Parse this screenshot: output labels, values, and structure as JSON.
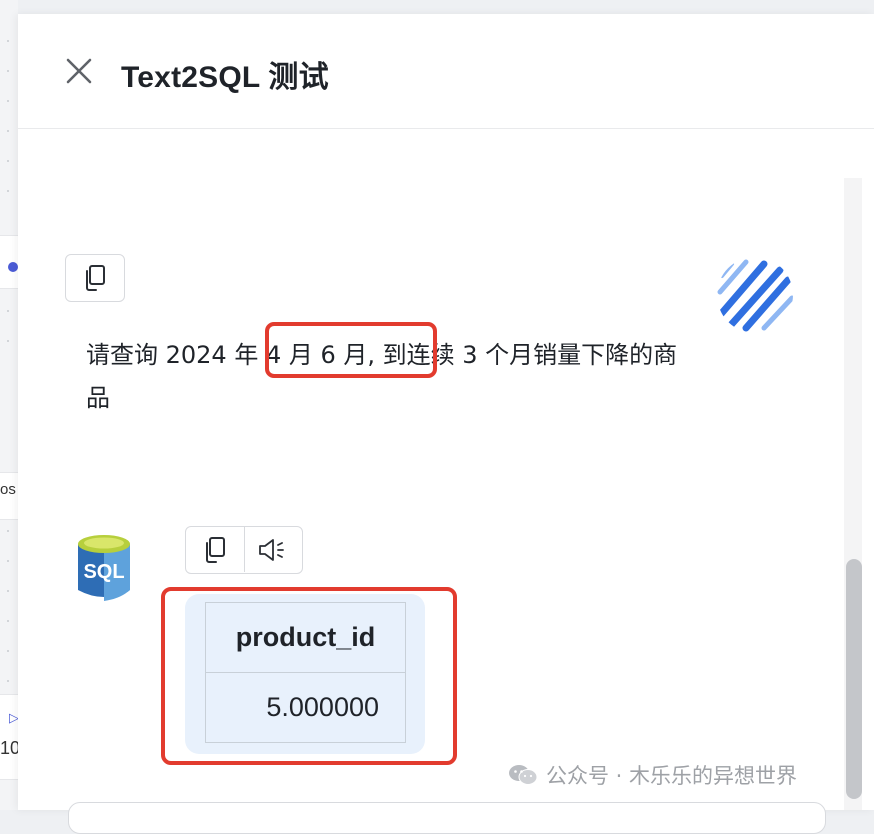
{
  "background": {
    "cut_text_1": "os",
    "cut_text_2": "10"
  },
  "drawer": {
    "title": "Text2SQL 测试",
    "close_icon": "close-icon"
  },
  "user_message": {
    "copy_icon": "copy-icon",
    "avatar_icon": "striped-logo-icon",
    "text": "请查询 2024 年 4 月 6 月, 到连续 3 个月销量下降的商品"
  },
  "bot_message": {
    "avatar_icon": "sql-database-icon",
    "avatar_label": "SQL",
    "actions": [
      {
        "icon": "copy-icon"
      },
      {
        "icon": "speaker-icon"
      }
    ],
    "table": {
      "columns": [
        "product_id"
      ],
      "rows": [
        [
          "5.000000"
        ]
      ]
    }
  },
  "watermark": {
    "text": "公众号 · 木乐乐的异想世界",
    "icon": "wechat-icon"
  },
  "colors": {
    "accent_red": "#e23b2e",
    "avatar_blue": "#2f6fe0",
    "card_bg": "#e8f1fc"
  }
}
